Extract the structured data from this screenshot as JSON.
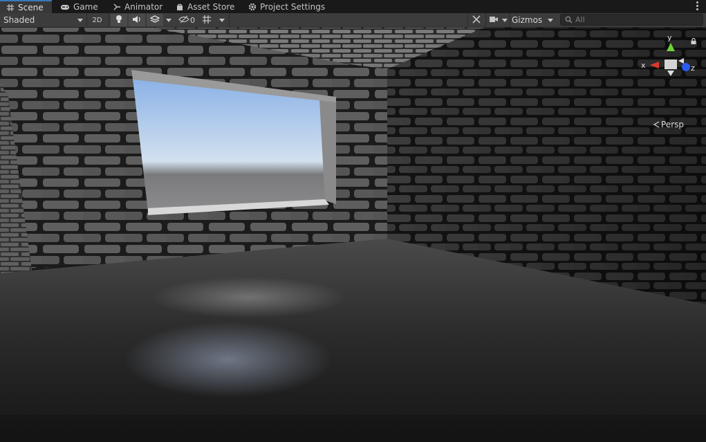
{
  "tabs": [
    {
      "label": "Scene",
      "icon": "grid-icon",
      "active": true
    },
    {
      "label": "Game",
      "icon": "gamepad-icon",
      "active": false
    },
    {
      "label": "Animator",
      "icon": "animator-icon",
      "active": false
    },
    {
      "label": "Asset Store",
      "icon": "bag-icon",
      "active": false
    },
    {
      "label": "Project Settings",
      "icon": "gear-icon",
      "active": false
    }
  ],
  "toolbar": {
    "shading_mode": "Shaded",
    "mode_2d": "2D",
    "hidden_count": "0",
    "gizmos_label": "Gizmos",
    "search_placeholder": "All"
  },
  "scene_gizmo": {
    "axis_x": "x",
    "axis_y": "y",
    "axis_z": "z",
    "projection": "Persp",
    "colors": {
      "x": "#d83a2c",
      "y": "#6fd13a",
      "z": "#2a5bf0"
    }
  }
}
